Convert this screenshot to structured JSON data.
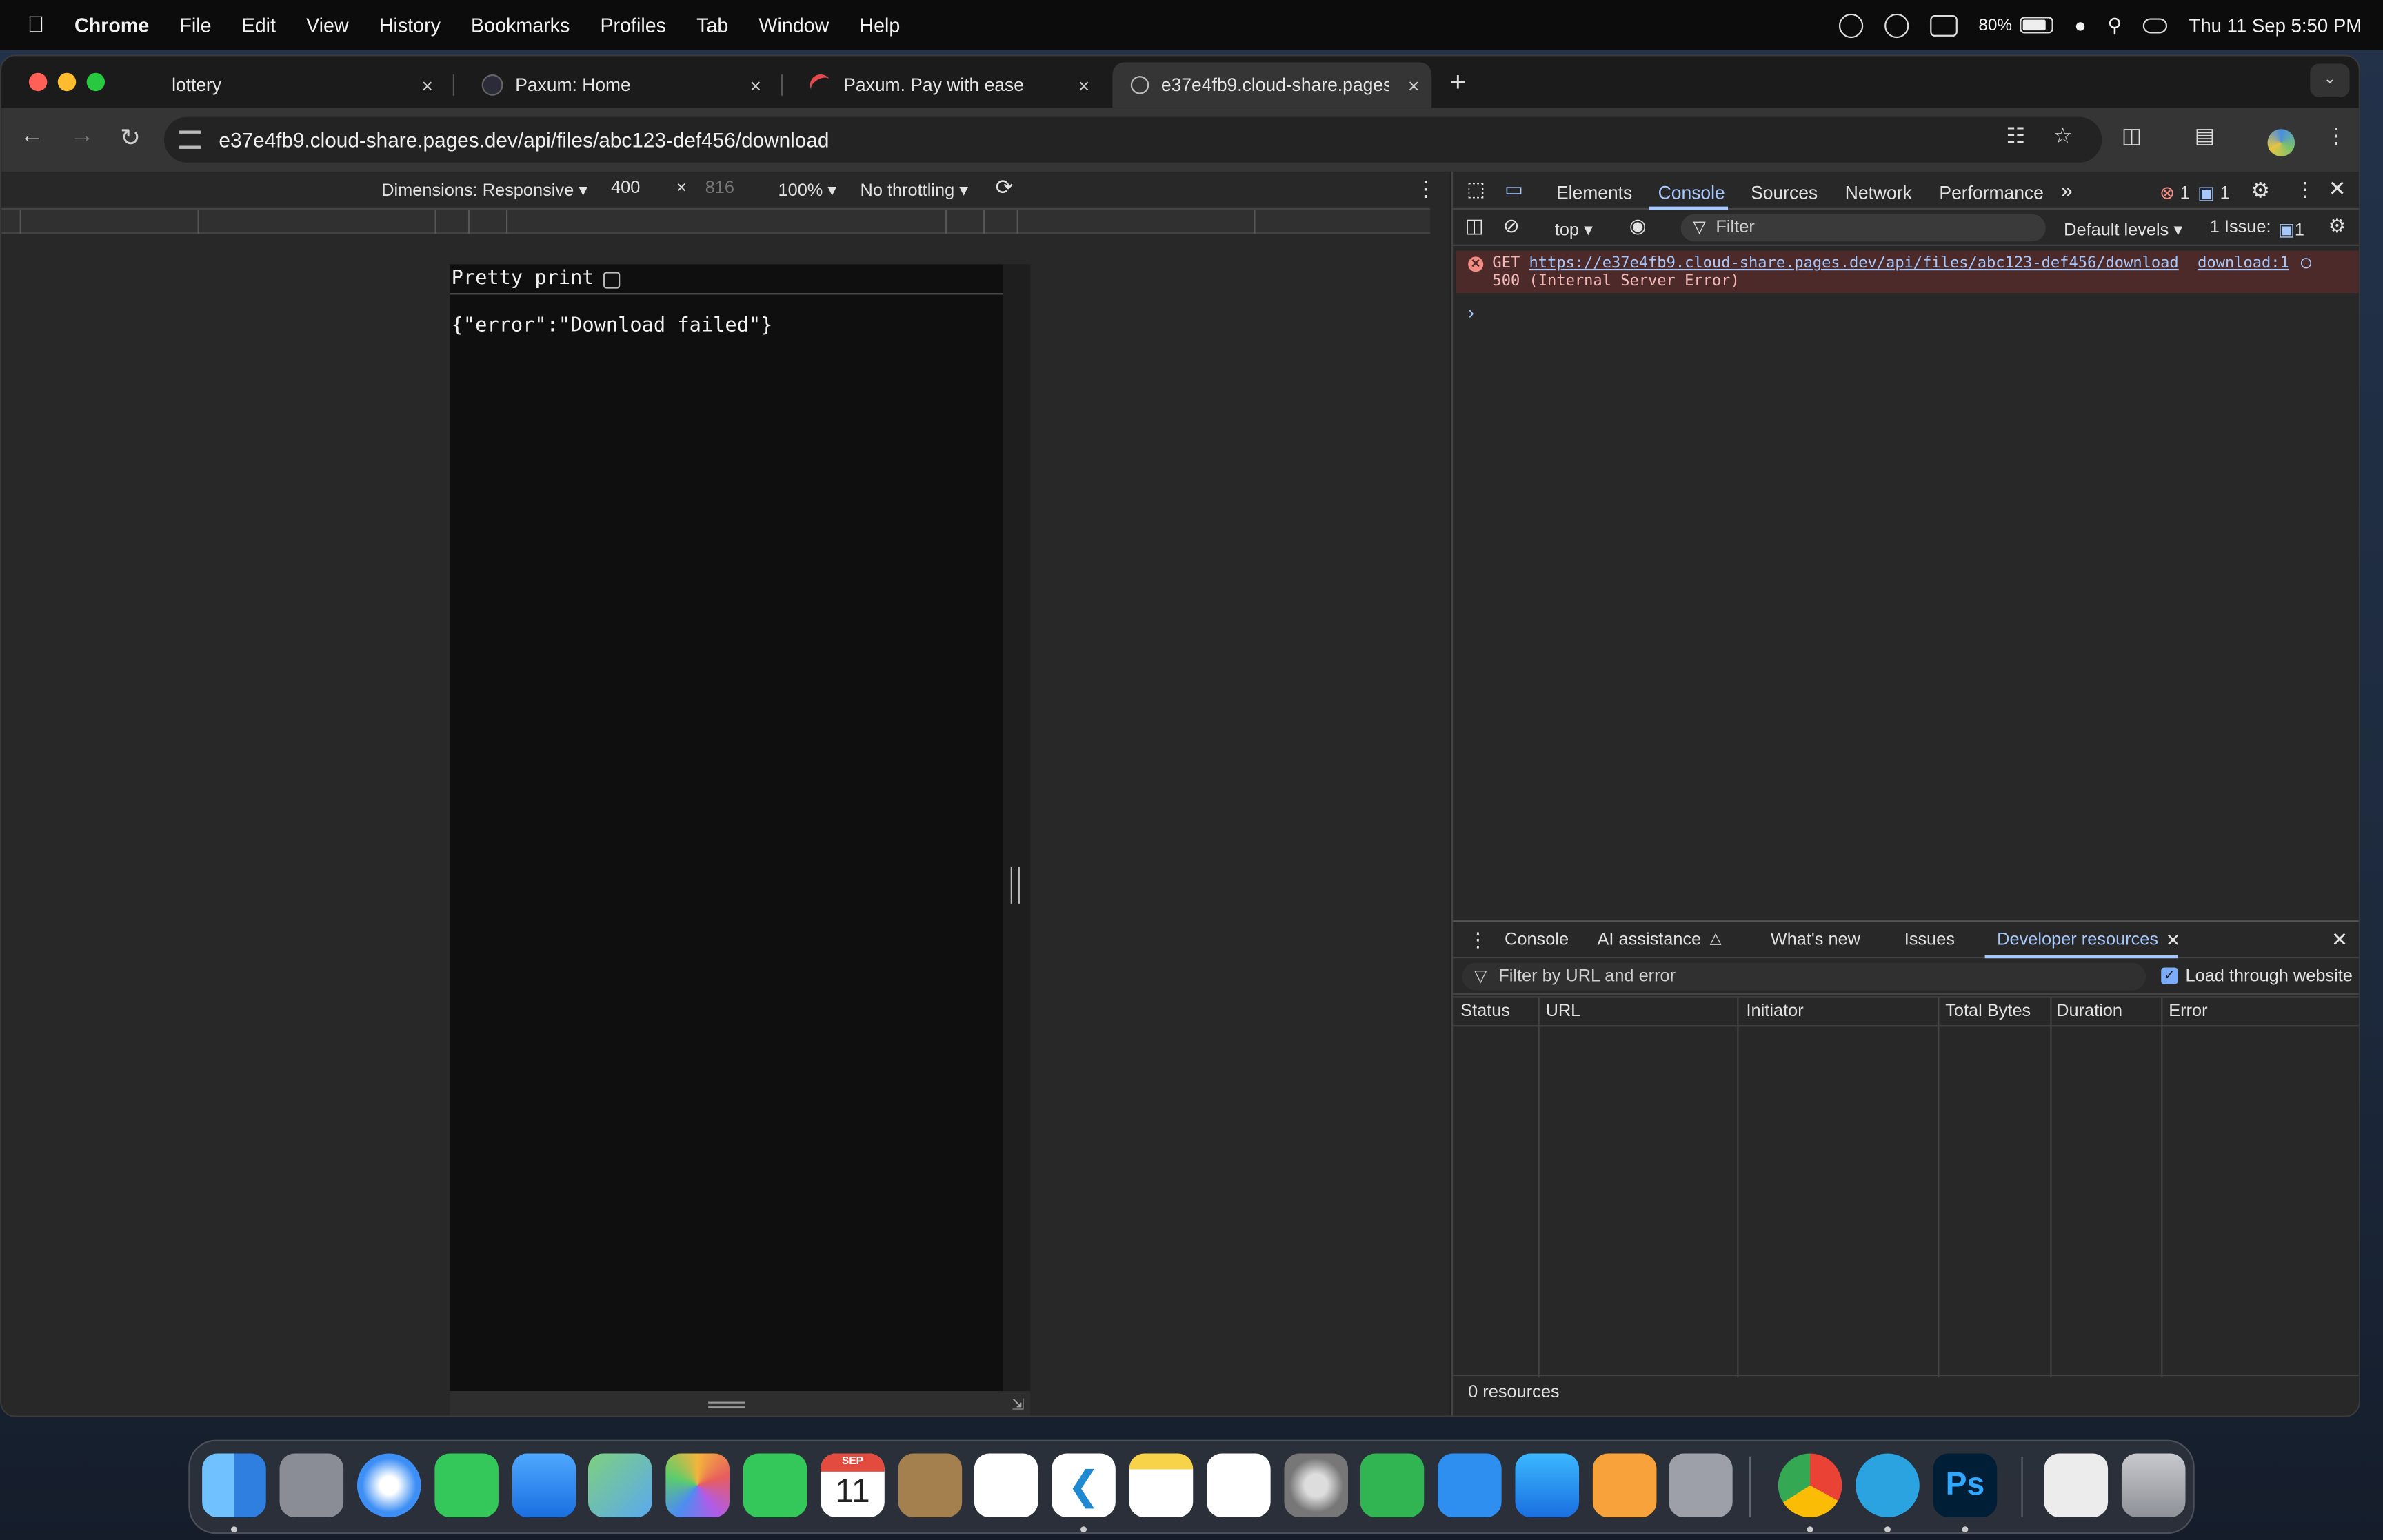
{
  "menubar": {
    "app": "Chrome",
    "items": [
      "File",
      "Edit",
      "View",
      "History",
      "Bookmarks",
      "Profiles",
      "Tab",
      "Window",
      "Help"
    ],
    "battery": "80%",
    "clock": "Thu 11 Sep  5:50 PM"
  },
  "tabs": [
    {
      "title": "lottery",
      "close": "×"
    },
    {
      "title": "Paxum: Home",
      "close": "×"
    },
    {
      "title": "Paxum. Pay with ease",
      "close": "×"
    },
    {
      "title": "e37e4fb9.cloud-share.pages",
      "close": "×"
    }
  ],
  "new_tab": "+",
  "address": {
    "url": "e37e4fb9.cloud-share.pages.dev/api/files/abc123-def456/download"
  },
  "device_toolbar": {
    "dimensions": "Dimensions: Responsive ▾",
    "width": "400",
    "times": "×",
    "height": "816",
    "zoom": "100% ▾",
    "throttling": "No throttling ▾"
  },
  "page": {
    "pretty_print_label": "Pretty print",
    "body_text": "{\"error\":\"Download failed\"}"
  },
  "devtools": {
    "tabs": [
      "Elements",
      "Console",
      "Sources",
      "Network",
      "Performance"
    ],
    "more_tabs": "»",
    "error_count": "1",
    "message_count": "1",
    "console_toolbar": {
      "context": "top ▾",
      "filter_placeholder": "Filter",
      "levels": "Default levels ▾",
      "issues": "1 Issue:",
      "issues_count": "1"
    },
    "error": {
      "method": "GET",
      "url": "https://e37e4fb9.cloud-share.pages.dev/api/files/abc123-def456/download",
      "status": "500 (Internal Server Error)",
      "source": "download:1"
    },
    "prompt": "›",
    "drawer": {
      "tabs": [
        "Console",
        "AI assistance",
        "What's new",
        "Issues",
        "Developer resources"
      ],
      "filter_placeholder": "Filter by URL and error",
      "load_through_website": "Load through website",
      "columns": [
        "Status",
        "URL",
        "Initiator",
        "Total Bytes",
        "Duration",
        "Error"
      ],
      "footer": "0 resources"
    }
  },
  "dock": {
    "calendar_month": "SEP",
    "calendar_day": "11",
    "photoshop_label": "Ps"
  }
}
